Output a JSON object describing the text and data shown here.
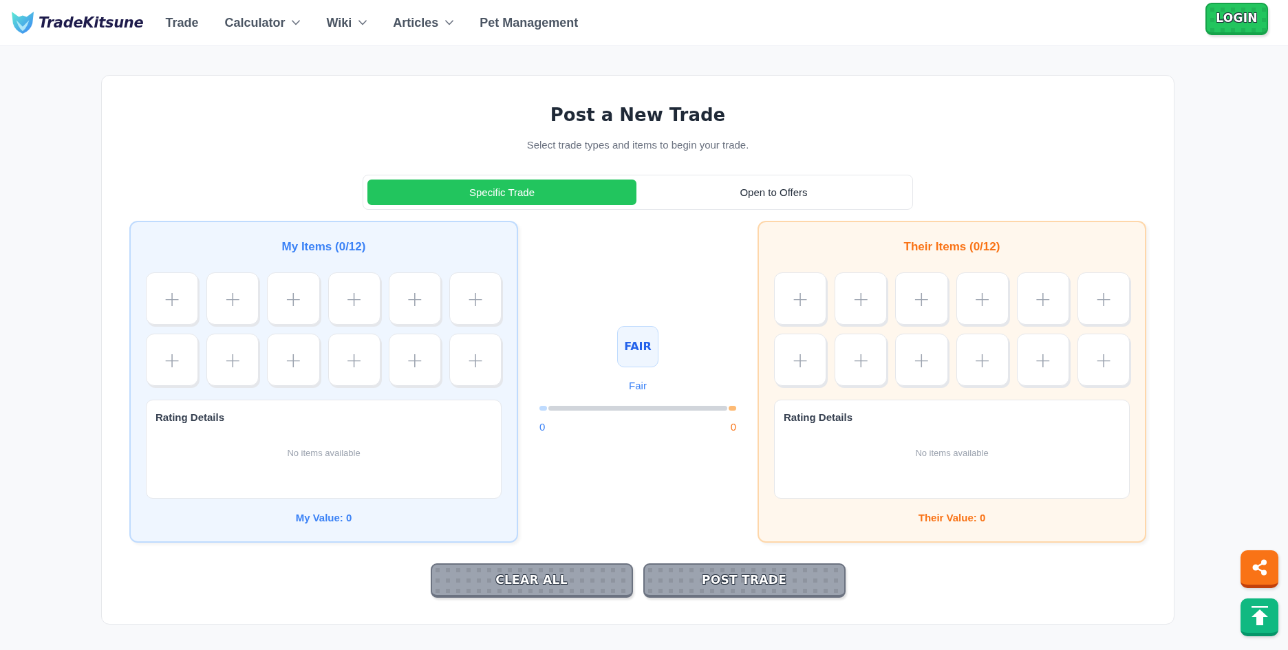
{
  "header": {
    "logo": {
      "text": "TradeKitsune"
    },
    "nav": [
      {
        "label": "Trade",
        "dropdown": false
      },
      {
        "label": "Calculator",
        "dropdown": true
      },
      {
        "label": "Wiki",
        "dropdown": true
      },
      {
        "label": "Articles",
        "dropdown": true
      },
      {
        "label": "Pet Management",
        "dropdown": false
      }
    ],
    "login_button": {
      "label": "LOGIN"
    }
  },
  "trade_form": {
    "title": "Post a New Trade",
    "subtitle": "Select trade types and items to begin your trade.",
    "trade_types": [
      {
        "label": "Specific Trade",
        "selected": true
      },
      {
        "label": "Open to Offers",
        "selected": false
      }
    ],
    "sides": [
      {
        "kind": "mine",
        "title": "My Items (0/12)",
        "slots": [
          {
            "label": "+"
          },
          {
            "label": "+"
          },
          {
            "label": "+"
          },
          {
            "label": "+"
          },
          {
            "label": "+"
          },
          {
            "label": "+"
          },
          {
            "label": "+"
          },
          {
            "label": "+"
          },
          {
            "label": "+"
          },
          {
            "label": "+"
          },
          {
            "label": "+"
          },
          {
            "label": "+"
          }
        ],
        "rating": {
          "title": "Rating Details",
          "empty_text": "No items available"
        },
        "value": "My Value: 0"
      },
      {
        "kind": "theirs",
        "title": "Their Items (0/12)",
        "slots": [
          {
            "label": "+"
          },
          {
            "label": "+"
          },
          {
            "label": "+"
          },
          {
            "label": "+"
          },
          {
            "label": "+"
          },
          {
            "label": "+"
          },
          {
            "label": "+"
          },
          {
            "label": "+"
          },
          {
            "label": "+"
          },
          {
            "label": "+"
          },
          {
            "label": "+"
          },
          {
            "label": "+"
          }
        ],
        "rating": {
          "title": "Rating Details",
          "empty_text": "No items available"
        },
        "value": "Their Value: 0"
      }
    ],
    "balance": {
      "badge": "FAIR",
      "label": "Fair",
      "bar": [
        {
          "level": 0.04
        },
        {
          "level": 0.04
        }
      ],
      "values": [
        {
          "kind": "mine",
          "text": "0"
        },
        {
          "kind": "theirs",
          "text": "0"
        }
      ]
    },
    "buttons": [
      {
        "label": "CLEAR ALL",
        "disabled": true
      },
      {
        "label": "POST TRADE",
        "disabled": true
      }
    ]
  },
  "floating_buttons": [
    {
      "kind": "share"
    },
    {
      "kind": "back_to_top"
    }
  ]
}
